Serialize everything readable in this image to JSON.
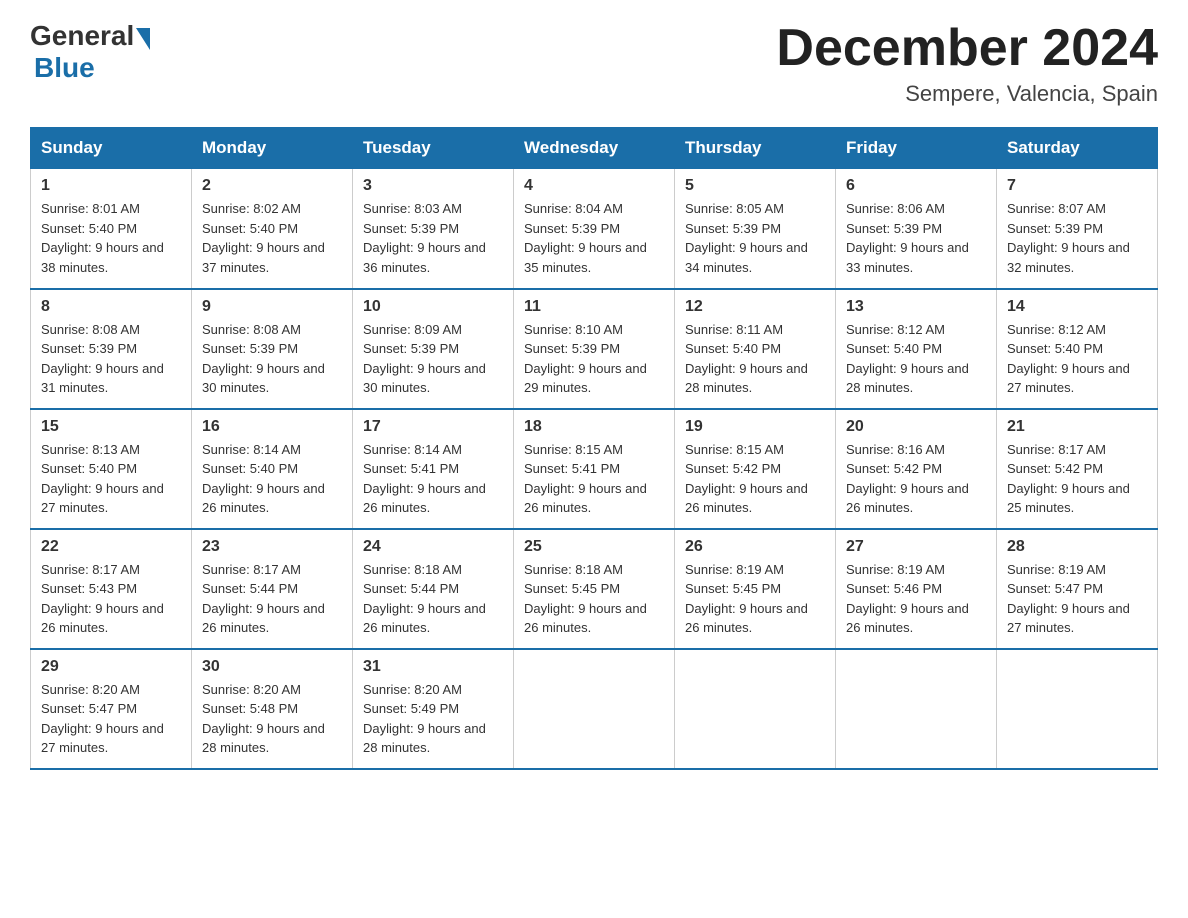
{
  "logo": {
    "general": "General",
    "blue": "Blue"
  },
  "title": "December 2024",
  "location": "Sempere, Valencia, Spain",
  "days_of_week": [
    "Sunday",
    "Monday",
    "Tuesday",
    "Wednesday",
    "Thursday",
    "Friday",
    "Saturday"
  ],
  "weeks": [
    [
      {
        "day": "1",
        "sunrise": "8:01 AM",
        "sunset": "5:40 PM",
        "daylight": "9 hours and 38 minutes."
      },
      {
        "day": "2",
        "sunrise": "8:02 AM",
        "sunset": "5:40 PM",
        "daylight": "9 hours and 37 minutes."
      },
      {
        "day": "3",
        "sunrise": "8:03 AM",
        "sunset": "5:39 PM",
        "daylight": "9 hours and 36 minutes."
      },
      {
        "day": "4",
        "sunrise": "8:04 AM",
        "sunset": "5:39 PM",
        "daylight": "9 hours and 35 minutes."
      },
      {
        "day": "5",
        "sunrise": "8:05 AM",
        "sunset": "5:39 PM",
        "daylight": "9 hours and 34 minutes."
      },
      {
        "day": "6",
        "sunrise": "8:06 AM",
        "sunset": "5:39 PM",
        "daylight": "9 hours and 33 minutes."
      },
      {
        "day": "7",
        "sunrise": "8:07 AM",
        "sunset": "5:39 PM",
        "daylight": "9 hours and 32 minutes."
      }
    ],
    [
      {
        "day": "8",
        "sunrise": "8:08 AM",
        "sunset": "5:39 PM",
        "daylight": "9 hours and 31 minutes."
      },
      {
        "day": "9",
        "sunrise": "8:08 AM",
        "sunset": "5:39 PM",
        "daylight": "9 hours and 30 minutes."
      },
      {
        "day": "10",
        "sunrise": "8:09 AM",
        "sunset": "5:39 PM",
        "daylight": "9 hours and 30 minutes."
      },
      {
        "day": "11",
        "sunrise": "8:10 AM",
        "sunset": "5:39 PM",
        "daylight": "9 hours and 29 minutes."
      },
      {
        "day": "12",
        "sunrise": "8:11 AM",
        "sunset": "5:40 PM",
        "daylight": "9 hours and 28 minutes."
      },
      {
        "day": "13",
        "sunrise": "8:12 AM",
        "sunset": "5:40 PM",
        "daylight": "9 hours and 28 minutes."
      },
      {
        "day": "14",
        "sunrise": "8:12 AM",
        "sunset": "5:40 PM",
        "daylight": "9 hours and 27 minutes."
      }
    ],
    [
      {
        "day": "15",
        "sunrise": "8:13 AM",
        "sunset": "5:40 PM",
        "daylight": "9 hours and 27 minutes."
      },
      {
        "day": "16",
        "sunrise": "8:14 AM",
        "sunset": "5:40 PM",
        "daylight": "9 hours and 26 minutes."
      },
      {
        "day": "17",
        "sunrise": "8:14 AM",
        "sunset": "5:41 PM",
        "daylight": "9 hours and 26 minutes."
      },
      {
        "day": "18",
        "sunrise": "8:15 AM",
        "sunset": "5:41 PM",
        "daylight": "9 hours and 26 minutes."
      },
      {
        "day": "19",
        "sunrise": "8:15 AM",
        "sunset": "5:42 PM",
        "daylight": "9 hours and 26 minutes."
      },
      {
        "day": "20",
        "sunrise": "8:16 AM",
        "sunset": "5:42 PM",
        "daylight": "9 hours and 26 minutes."
      },
      {
        "day": "21",
        "sunrise": "8:17 AM",
        "sunset": "5:42 PM",
        "daylight": "9 hours and 25 minutes."
      }
    ],
    [
      {
        "day": "22",
        "sunrise": "8:17 AM",
        "sunset": "5:43 PM",
        "daylight": "9 hours and 26 minutes."
      },
      {
        "day": "23",
        "sunrise": "8:17 AM",
        "sunset": "5:44 PM",
        "daylight": "9 hours and 26 minutes."
      },
      {
        "day": "24",
        "sunrise": "8:18 AM",
        "sunset": "5:44 PM",
        "daylight": "9 hours and 26 minutes."
      },
      {
        "day": "25",
        "sunrise": "8:18 AM",
        "sunset": "5:45 PM",
        "daylight": "9 hours and 26 minutes."
      },
      {
        "day": "26",
        "sunrise": "8:19 AM",
        "sunset": "5:45 PM",
        "daylight": "9 hours and 26 minutes."
      },
      {
        "day": "27",
        "sunrise": "8:19 AM",
        "sunset": "5:46 PM",
        "daylight": "9 hours and 26 minutes."
      },
      {
        "day": "28",
        "sunrise": "8:19 AM",
        "sunset": "5:47 PM",
        "daylight": "9 hours and 27 minutes."
      }
    ],
    [
      {
        "day": "29",
        "sunrise": "8:20 AM",
        "sunset": "5:47 PM",
        "daylight": "9 hours and 27 minutes."
      },
      {
        "day": "30",
        "sunrise": "8:20 AM",
        "sunset": "5:48 PM",
        "daylight": "9 hours and 28 minutes."
      },
      {
        "day": "31",
        "sunrise": "8:20 AM",
        "sunset": "5:49 PM",
        "daylight": "9 hours and 28 minutes."
      },
      null,
      null,
      null,
      null
    ]
  ]
}
